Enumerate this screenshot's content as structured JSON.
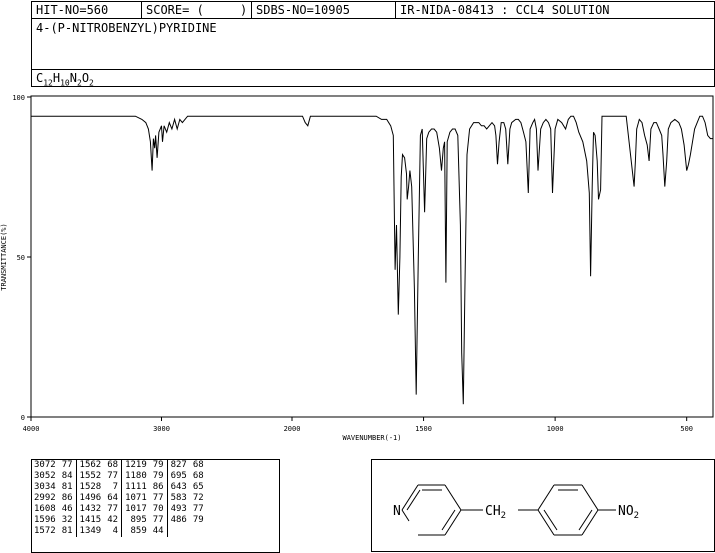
{
  "header": {
    "hit_no": "HIT-NO=560",
    "score_label": "SCORE=",
    "score_value": "(     )",
    "sdbs_no": "SDBS-NO=10905",
    "ir_nida": "IR-NIDA-08413 : CCL4 SOLUTION"
  },
  "compound": {
    "name": "4-(P-NITROBENZYL)PYRIDINE",
    "formula_parts": [
      "C",
      "12",
      "H",
      "10",
      "N",
      "2",
      "O",
      "2"
    ]
  },
  "structure": {
    "pyridine_n": "N",
    "linker": "CH",
    "linker_sub": "2",
    "nitro": "NO",
    "nitro_sub": "2"
  },
  "chart_data": {
    "type": "line",
    "xlabel": "WAVENUMBER(-1)",
    "ylabel": "TRANSMITTANCE(%)",
    "xlim": [
      4000,
      400
    ],
    "ylim": [
      0,
      100
    ],
    "xticks": [
      4000,
      3000,
      2000,
      1500,
      1000,
      500
    ],
    "xtick_labels": [
      "4000",
      "3000",
      "2000",
      "1500",
      "1000",
      "500"
    ],
    "yticks": [
      0,
      50,
      100
    ],
    "ytick_labels": [
      "0",
      "50",
      "100"
    ],
    "grid": false,
    "series": [
      {
        "x": [
          4000,
          3900,
          3800,
          3700,
          3600,
          3500,
          3400,
          3300,
          3200,
          3150,
          3120,
          3100,
          3085,
          3072,
          3062,
          3052,
          3045,
          3034,
          3020,
          3000,
          2992,
          2980,
          2960,
          2940,
          2920,
          2900,
          2880,
          2860,
          2840,
          2800,
          2700,
          2600,
          2500,
          2400,
          2300,
          2200,
          2100,
          2000,
          1960,
          1950,
          1940,
          1930,
          1920,
          1900,
          1850,
          1800,
          1750,
          1720,
          1700,
          1680,
          1660,
          1640,
          1625,
          1615,
          1608,
          1603,
          1596,
          1590,
          1585,
          1580,
          1572,
          1565,
          1562,
          1557,
          1552,
          1545,
          1535,
          1528,
          1520,
          1512,
          1505,
          1496,
          1488,
          1480,
          1470,
          1460,
          1450,
          1440,
          1432,
          1425,
          1420,
          1415,
          1410,
          1400,
          1390,
          1380,
          1370,
          1360,
          1355,
          1349,
          1343,
          1335,
          1325,
          1310,
          1300,
          1290,
          1280,
          1270,
          1260,
          1250,
          1240,
          1230,
          1225,
          1219,
          1213,
          1205,
          1195,
          1188,
          1180,
          1172,
          1165,
          1150,
          1140,
          1130,
          1120,
          1111,
          1102,
          1095,
          1085,
          1078,
          1071,
          1065,
          1055,
          1045,
          1035,
          1025,
          1017,
          1010,
          1000,
          990,
          975,
          960,
          950,
          940,
          930,
          920,
          910,
          895,
          880,
          870,
          865,
          859,
          854,
          848,
          840,
          835,
          827,
          822,
          810,
          790,
          770,
          750,
          730,
          700,
          695,
          690,
          680,
          670,
          660,
          650,
          643,
          636,
          625,
          615,
          605,
          595,
          590,
          583,
          576,
          570,
          560,
          545,
          530,
          520,
          510,
          500,
          493,
          486,
          478,
          470,
          460,
          450,
          440,
          430,
          420,
          410,
          400
        ],
        "y": [
          94,
          94,
          94,
          94,
          94,
          94,
          94,
          94,
          94,
          93,
          92,
          90,
          86,
          77,
          87,
          84,
          88,
          81,
          89,
          91,
          86,
          91,
          89,
          92,
          90,
          93,
          90,
          93,
          92,
          94,
          94,
          94,
          94,
          94,
          94,
          94,
          94,
          94,
          94,
          92,
          91,
          94,
          94,
          94,
          94,
          94,
          94,
          94,
          94,
          94,
          93,
          93,
          91,
          88,
          46,
          60,
          32,
          50,
          75,
          82,
          81,
          76,
          68,
          72,
          77,
          72,
          40,
          7,
          50,
          88,
          90,
          64,
          87,
          89,
          90,
          90,
          89,
          84,
          77,
          84,
          86,
          42,
          86,
          89,
          90,
          90,
          88,
          60,
          20,
          4,
          40,
          82,
          90,
          92,
          92,
          92,
          91,
          91,
          90,
          91,
          92,
          91,
          88,
          79,
          86,
          92,
          92,
          90,
          79,
          90,
          92,
          93,
          93,
          92,
          89,
          86,
          70,
          90,
          92,
          93,
          90,
          77,
          90,
          92,
          93,
          92,
          90,
          70,
          90,
          93,
          92,
          90,
          93,
          94,
          94,
          92,
          89,
          86,
          80,
          70,
          44,
          72,
          89,
          88,
          80,
          68,
          71,
          94,
          94,
          94,
          94,
          94,
          94,
          72,
          80,
          90,
          93,
          92,
          88,
          85,
          80,
          90,
          92,
          92,
          90,
          88,
          82,
          72,
          80,
          90,
          92,
          93,
          92,
          90,
          85,
          77,
          79,
          82,
          86,
          90,
          92,
          94,
          94,
          92,
          88,
          87,
          87
        ]
      }
    ]
  },
  "peaks": [
    [
      [
        "3072",
        "77"
      ],
      [
        "3052",
        "84"
      ],
      [
        "3034",
        "81"
      ],
      [
        "2992",
        "86"
      ],
      [
        "1608",
        "46"
      ],
      [
        "1596",
        "32"
      ],
      [
        "1572",
        "81"
      ]
    ],
    [
      [
        "1562",
        "68"
      ],
      [
        "1552",
        "77"
      ],
      [
        "1528",
        "7"
      ],
      [
        "1496",
        "64"
      ],
      [
        "1432",
        "77"
      ],
      [
        "1415",
        "42"
      ],
      [
        "1349",
        "4"
      ]
    ],
    [
      [
        "1219",
        "79"
      ],
      [
        "1180",
        "79"
      ],
      [
        "1111",
        "86"
      ],
      [
        "1071",
        "77"
      ],
      [
        "1017",
        "70"
      ],
      [
        "895",
        "77"
      ],
      [
        "859",
        "44"
      ]
    ],
    [
      [
        "827",
        "68"
      ],
      [
        "695",
        "68"
      ],
      [
        "643",
        "65"
      ],
      [
        "583",
        "72"
      ],
      [
        "493",
        "77"
      ],
      [
        "486",
        "79"
      ],
      [
        "",
        ""
      ]
    ]
  ]
}
